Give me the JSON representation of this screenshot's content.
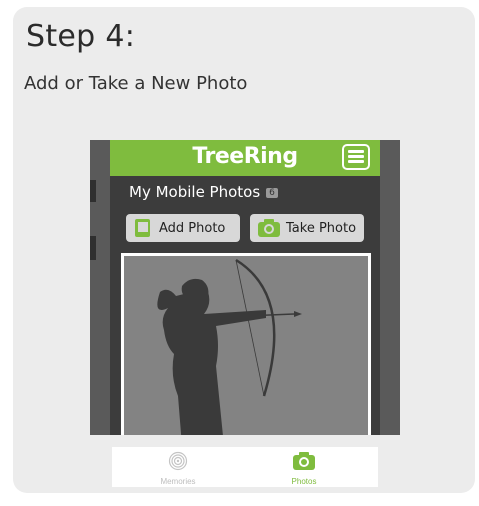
{
  "instruction": {
    "step_title": "Step 4:",
    "subtitle": "Add or Take a New Photo"
  },
  "app": {
    "logo": "TreeRing",
    "page_title": "My Mobile Photos",
    "photo_count": "6",
    "add_photo_label": "Add Photo",
    "take_photo_label": "Take Photo"
  },
  "tabs": [
    {
      "label": "Memories",
      "icon": "fingerprint-icon"
    },
    {
      "label": "Photos",
      "icon": "camera-icon"
    }
  ],
  "colors": {
    "brand_green": "#7fbc3e",
    "dark_bg": "#3c3c3c",
    "card_bg": "#ececec"
  }
}
